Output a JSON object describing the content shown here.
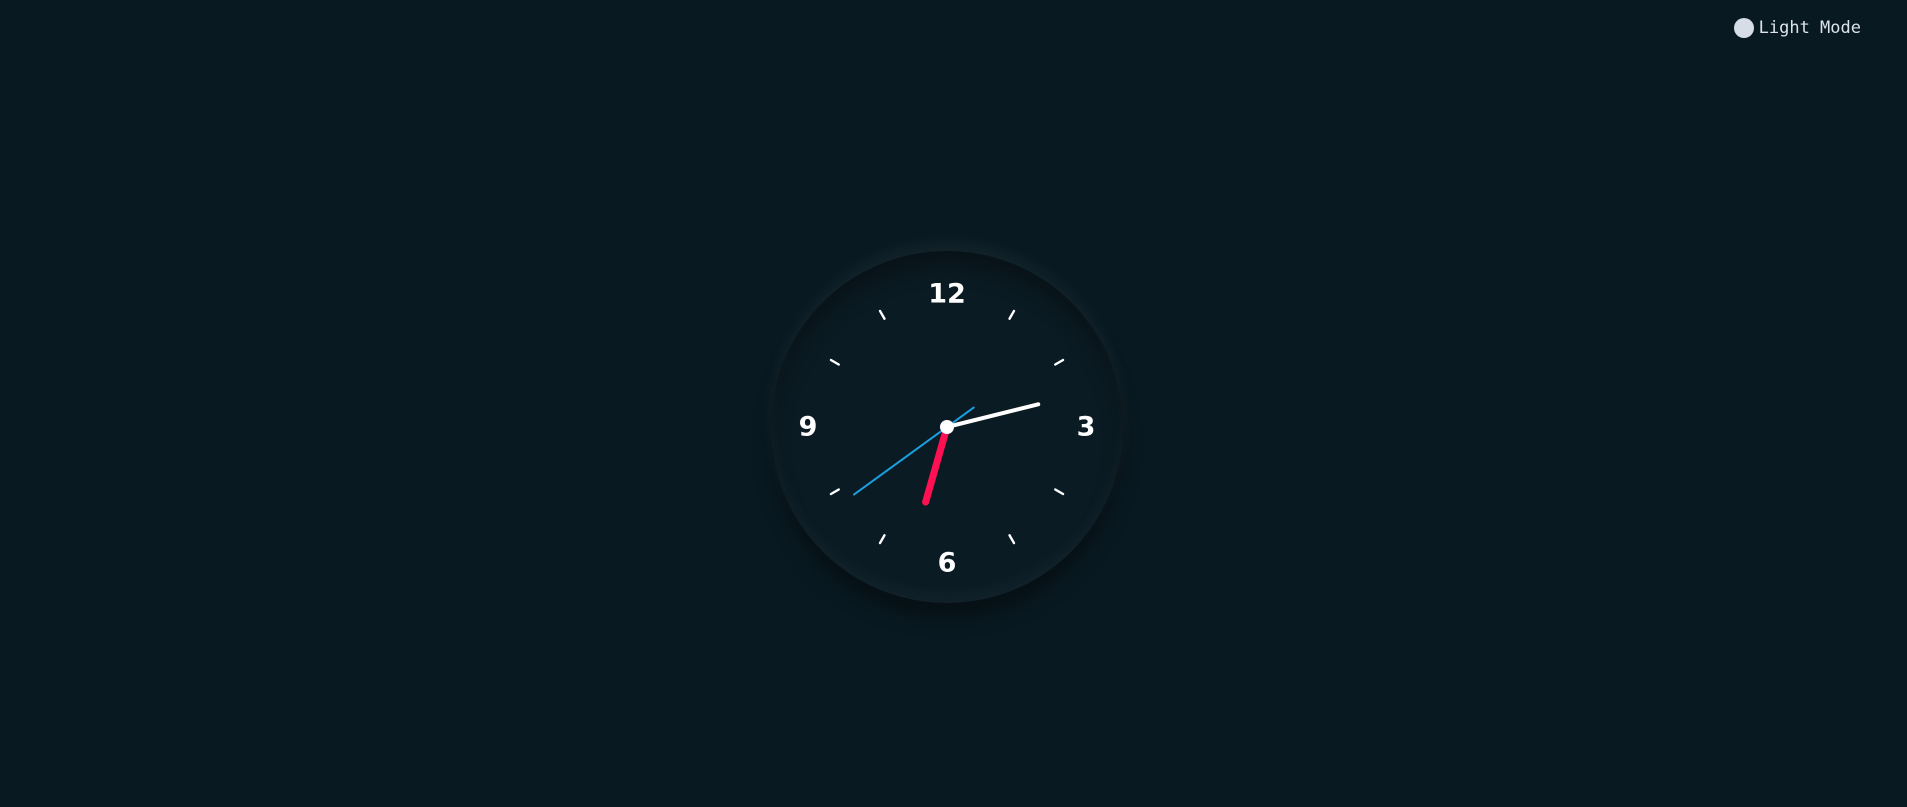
{
  "theme_toggle": {
    "label": "Light Mode",
    "icon": "circle-icon"
  },
  "clock": {
    "numerals": {
      "n12": "12",
      "n3": "3",
      "n6": "6",
      "n9": "9"
    },
    "time": {
      "hours": 2,
      "minutes": 32,
      "seconds": 39
    },
    "colors": {
      "background": "#091921",
      "face": "#0b1b23",
      "hour_hand": "#ffffff",
      "minute_hand": "#ff1053",
      "second_hand": "#1a9fe0",
      "ticks": "#ffffff",
      "center": "#ffffff"
    }
  }
}
